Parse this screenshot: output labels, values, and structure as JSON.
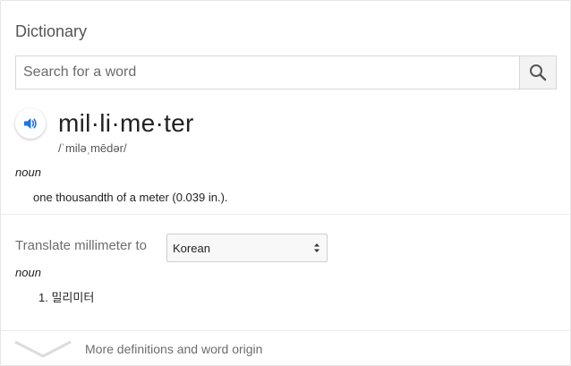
{
  "panel": {
    "title": "Dictionary"
  },
  "search": {
    "placeholder": "Search for a word",
    "value": "",
    "button_icon": "search-icon"
  },
  "entry": {
    "speaker_icon": "speaker-icon",
    "word": "mil·li·me·ter",
    "pronunciation": "/ˈmiləˌmēdər/",
    "part_of_speech": "noun",
    "definition": "one thousandth of a meter (0.039 in.)."
  },
  "translate": {
    "label": "Translate millimeter to",
    "selected_language": "Korean",
    "part_of_speech": "noun",
    "items": [
      "1. 밀리미터"
    ]
  },
  "footer": {
    "more_label": "More definitions and word origin",
    "chevron_icon": "chevron-down-icon"
  },
  "colors": {
    "accent_blue": "#1a73e8",
    "muted_text": "#6d6d6d"
  }
}
